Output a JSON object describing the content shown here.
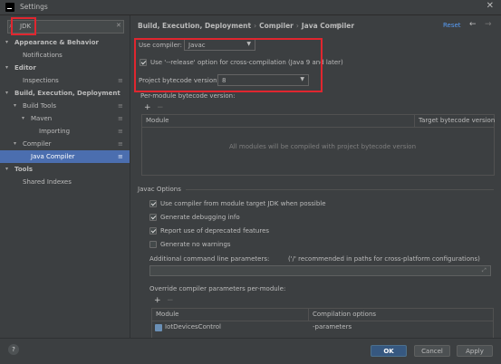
{
  "window": {
    "title": "Settings"
  },
  "search": {
    "value": "JDK"
  },
  "tree": [
    {
      "label": "Appearance & Behavior",
      "bold": true
    },
    {
      "label": "Notifications"
    },
    {
      "label": "Editor",
      "bold": true
    },
    {
      "label": "Inspections"
    },
    {
      "label": "Build, Execution, Deployment",
      "bold": true
    },
    {
      "label": "Build Tools"
    },
    {
      "label": "Maven"
    },
    {
      "label": "Importing"
    },
    {
      "label": "Compiler"
    },
    {
      "label": "Java Compiler",
      "selected": true
    },
    {
      "label": "Tools",
      "bold": true
    },
    {
      "label": "Shared Indexes"
    }
  ],
  "breadcrumb": {
    "part1": "Build, Execution, Deployment",
    "part2": "Compiler",
    "part3": "Java Compiler"
  },
  "header": {
    "reset": "Reset"
  },
  "compiler": {
    "use_compiler_label": "Use compiler:",
    "use_compiler_value": "Javac",
    "release_option_label": "Use '--release' option for cross-compilation (Java 9 and later)",
    "release_option_checked": true,
    "bytecode_label": "Project bytecode version:",
    "bytecode_value": "8"
  },
  "per_module": {
    "title": "Per-module bytecode version:",
    "col_module": "Module",
    "col_target": "Target bytecode version",
    "empty_text": "All modules will be compiled with project bytecode version"
  },
  "javac": {
    "title": "Javac Options",
    "options": [
      {
        "label": "Use compiler from module target JDK when possible",
        "checked": true
      },
      {
        "label": "Generate debugging info",
        "checked": true
      },
      {
        "label": "Report use of deprecated features",
        "checked": true
      },
      {
        "label": "Generate no warnings",
        "checked": false
      }
    ],
    "additional_label": "Additional command line parameters:",
    "additional_hint": "('/' recommended in paths for cross-platform configurations)",
    "additional_value": "",
    "override_label": "Override compiler parameters per-module:",
    "col_module": "Module",
    "col_options": "Compilation options",
    "rows": [
      {
        "module": "IotDevicesControl",
        "options": "-parameters"
      }
    ]
  },
  "footer": {
    "ok": "OK",
    "cancel": "Cancel",
    "apply": "Apply",
    "help": "?"
  },
  "colors": {
    "accent": "#4b6eaf",
    "highlight": "#e0262f",
    "link": "#589df6"
  }
}
